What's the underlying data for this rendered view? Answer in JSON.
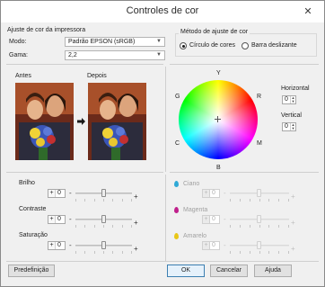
{
  "window": {
    "title": "Controles de cor",
    "close_icon": "close-icon"
  },
  "printer_settings": {
    "group_label": "Ajuste de cor da impressora",
    "mode_label": "Modo:",
    "mode_value": "Padrão EPSON (sRGB)",
    "gamma_label": "Gama:",
    "gamma_value": "2,2"
  },
  "method": {
    "group_label": "Método de ajuste de cor",
    "options": [
      "Círculo de cores",
      "Barra deslizante"
    ],
    "selected": "Círculo de cores"
  },
  "preview": {
    "before_label": "Antes",
    "after_label": "Depois"
  },
  "wheel": {
    "labels": {
      "Y": "Y",
      "R": "R",
      "M": "M",
      "B": "B",
      "C": "C",
      "G": "G"
    },
    "horizontal_label": "Horizontal",
    "horizontal_value": "0",
    "vertical_label": "Vertical",
    "vertical_value": "0"
  },
  "adjustments": [
    {
      "label": "Brilho",
      "sign": "+",
      "value": "0",
      "level": 0.5
    },
    {
      "label": "Contraste",
      "sign": "+",
      "value": "0",
      "level": 0.5
    },
    {
      "label": "Saturação",
      "sign": "+",
      "value": "0",
      "level": 0.5
    }
  ],
  "inks": [
    {
      "label": "Ciano",
      "sign": "+",
      "value": "0",
      "color": "#2fa9d6",
      "icon": "cyan-drop-icon",
      "level": 0.5
    },
    {
      "label": "Magenta",
      "sign": "+",
      "value": "0",
      "color": "#c0208c",
      "icon": "magenta-drop-icon",
      "level": 0.5
    },
    {
      "label": "Amarelo",
      "sign": "+",
      "value": "0",
      "color": "#e8c617",
      "icon": "yellow-drop-icon",
      "level": 0.5
    }
  ],
  "slider_ends": {
    "minus": "-",
    "plus": "+"
  },
  "buttons": {
    "default": "Predefinição",
    "ok": "OK",
    "cancel": "Cancelar",
    "help": "Ajuda"
  },
  "colors": {
    "accent": "#3c7fb1",
    "window_bg": "#f0f0f0"
  }
}
